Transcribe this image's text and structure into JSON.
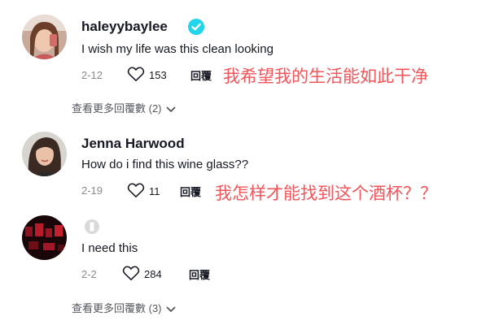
{
  "comments": [
    {
      "username": "haleyybaylee",
      "verified": true,
      "text": "I wish my life was this clean looking",
      "date": "2-12",
      "likes": "153",
      "reply_label": "回覆",
      "translation": "我希望我的生活能如此干净",
      "view_more": "查看更多回覆數 (2)"
    },
    {
      "username": "Jenna Harwood",
      "verified": false,
      "text": "How do i find this wine glass??",
      "date": "2-19",
      "likes": "11",
      "reply_label": "回覆",
      "translation": "我怎样才能找到这个酒杯？？"
    },
    {
      "username": "",
      "verified": false,
      "text": "I need this",
      "date": "2-2",
      "likes": "284",
      "reply_label": "回覆",
      "view_more": "查看更多回覆數 (3)"
    }
  ],
  "colors": {
    "translation": "#f2555a",
    "verified": "#20d5ec",
    "secondary_text": "#8a8b91"
  },
  "icons": [
    "heart-outline-icon",
    "verified-check-icon",
    "chevron-down-icon"
  ]
}
